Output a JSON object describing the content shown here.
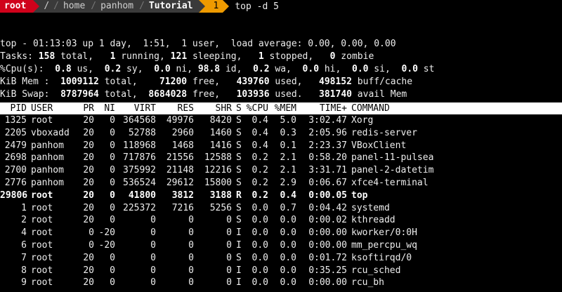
{
  "prompt": {
    "user": "root",
    "path_root": "/",
    "path": [
      "home",
      "panhom"
    ],
    "current_dir": "Tutorial",
    "jobs": "1",
    "command": "top -d 5"
  },
  "summary": {
    "l1_a": "top - 01:13:03 up 1 day,  1:51,  1 user,  load average: 0.00, 0.00, 0.00",
    "tasks_label": "Tasks: ",
    "tasks_total": "158",
    "tasks_total_label": " total,   ",
    "tasks_running": "1",
    "tasks_running_label": " running, ",
    "tasks_sleeping": "121",
    "tasks_sleeping_label": " sleeping,   ",
    "tasks_stopped": "1",
    "tasks_stopped_label": " stopped,   ",
    "tasks_zombie": "0",
    "tasks_zombie_label": " zombie",
    "cpu_label": "%Cpu(s):  ",
    "cpu_us": "0.8",
    "cpu_us_label": " us,  ",
    "cpu_sy": "0.2",
    "cpu_sy_label": " sy,  ",
    "cpu_ni": "0.0",
    "cpu_ni_label": " ni, ",
    "cpu_id": "98.8",
    "cpu_id_label": " id,  ",
    "cpu_wa": "0.2",
    "cpu_wa_label": " wa,  ",
    "cpu_hi": "0.0",
    "cpu_hi_label": " hi,  ",
    "cpu_si": "0.0",
    "cpu_si_label": " si,  ",
    "cpu_st": "0.0",
    "cpu_st_label": " st",
    "mem_label": "KiB Mem :  ",
    "mem_total": "1009112",
    "mem_total_label": " total,    ",
    "mem_free": "71200",
    "mem_free_label": " free,   ",
    "mem_used": "439760",
    "mem_used_label": " used,   ",
    "mem_cache": "498152",
    "mem_cache_label": " buff/cache",
    "swap_label": "KiB Swap:  ",
    "swap_total": "8787964",
    "swap_total_label": " total,  ",
    "swap_free": "8684028",
    "swap_free_label": " free,   ",
    "swap_used": "103936",
    "swap_used_label": " used.   ",
    "swap_avail": "381740",
    "swap_avail_label": " avail Mem"
  },
  "table": {
    "headers": {
      "pid": "PID",
      "user": "USER",
      "pr": "PR",
      "ni": "NI",
      "virt": "VIRT",
      "res": "RES",
      "shr": "SHR",
      "s": "S",
      "cpu": "%CPU",
      "mem": "%MEM",
      "time": "TIME+",
      "command": "COMMAND"
    },
    "rows": [
      {
        "pid": "1325",
        "user": "root",
        "pr": "20",
        "ni": "0",
        "virt": "364568",
        "res": "49976",
        "shr": "8420",
        "s": "S",
        "cpu": "0.4",
        "mem": "5.0",
        "time": "3:02.47",
        "command": "Xorg"
      },
      {
        "pid": "2205",
        "user": "vboxadd",
        "pr": "20",
        "ni": "0",
        "virt": "52788",
        "res": "2960",
        "shr": "1460",
        "s": "S",
        "cpu": "0.4",
        "mem": "0.3",
        "time": "2:05.96",
        "command": "redis-server"
      },
      {
        "pid": "2479",
        "user": "panhom",
        "pr": "20",
        "ni": "0",
        "virt": "118968",
        "res": "1468",
        "shr": "1416",
        "s": "S",
        "cpu": "0.4",
        "mem": "0.1",
        "time": "2:23.37",
        "command": "VBoxClient"
      },
      {
        "pid": "2698",
        "user": "panhom",
        "pr": "20",
        "ni": "0",
        "virt": "717876",
        "res": "21556",
        "shr": "12588",
        "s": "S",
        "cpu": "0.2",
        "mem": "2.1",
        "time": "0:58.20",
        "command": "panel-11-pulsea"
      },
      {
        "pid": "2700",
        "user": "panhom",
        "pr": "20",
        "ni": "0",
        "virt": "375992",
        "res": "21148",
        "shr": "12216",
        "s": "S",
        "cpu": "0.2",
        "mem": "2.1",
        "time": "3:31.71",
        "command": "panel-2-datetim"
      },
      {
        "pid": "2776",
        "user": "panhom",
        "pr": "20",
        "ni": "0",
        "virt": "536524",
        "res": "29612",
        "shr": "15800",
        "s": "S",
        "cpu": "0.2",
        "mem": "2.9",
        "time": "0:06.67",
        "command": "xfce4-terminal"
      },
      {
        "pid": "29806",
        "user": "root",
        "pr": "20",
        "ni": "0",
        "virt": "41800",
        "res": "3812",
        "shr": "3188",
        "s": "R",
        "cpu": "0.2",
        "mem": "0.4",
        "time": "0:00.05",
        "command": "top"
      },
      {
        "pid": "1",
        "user": "root",
        "pr": "20",
        "ni": "0",
        "virt": "225372",
        "res": "7216",
        "shr": "5256",
        "s": "S",
        "cpu": "0.0",
        "mem": "0.7",
        "time": "0:04.42",
        "command": "systemd"
      },
      {
        "pid": "2",
        "user": "root",
        "pr": "20",
        "ni": "0",
        "virt": "0",
        "res": "0",
        "shr": "0",
        "s": "S",
        "cpu": "0.0",
        "mem": "0.0",
        "time": "0:00.02",
        "command": "kthreadd"
      },
      {
        "pid": "4",
        "user": "root",
        "pr": "0",
        "ni": "-20",
        "virt": "0",
        "res": "0",
        "shr": "0",
        "s": "I",
        "cpu": "0.0",
        "mem": "0.0",
        "time": "0:00.00",
        "command": "kworker/0:0H"
      },
      {
        "pid": "6",
        "user": "root",
        "pr": "0",
        "ni": "-20",
        "virt": "0",
        "res": "0",
        "shr": "0",
        "s": "I",
        "cpu": "0.0",
        "mem": "0.0",
        "time": "0:00.00",
        "command": "mm_percpu_wq"
      },
      {
        "pid": "7",
        "user": "root",
        "pr": "20",
        "ni": "0",
        "virt": "0",
        "res": "0",
        "shr": "0",
        "s": "S",
        "cpu": "0.0",
        "mem": "0.0",
        "time": "0:01.72",
        "command": "ksoftirqd/0"
      },
      {
        "pid": "8",
        "user": "root",
        "pr": "20",
        "ni": "0",
        "virt": "0",
        "res": "0",
        "shr": "0",
        "s": "I",
        "cpu": "0.0",
        "mem": "0.0",
        "time": "0:35.25",
        "command": "rcu_sched"
      },
      {
        "pid": "9",
        "user": "root",
        "pr": "20",
        "ni": "0",
        "virt": "0",
        "res": "0",
        "shr": "0",
        "s": "I",
        "cpu": "0.0",
        "mem": "0.0",
        "time": "0:00.00",
        "command": "rcu_bh"
      }
    ],
    "highlight_row": 6
  },
  "colors": {
    "prompt_user_bg": "#d0021b",
    "prompt_path_bg": "#3a3a3a",
    "prompt_job_bg": "#ee9a00",
    "header_bg": "#ffffff"
  }
}
